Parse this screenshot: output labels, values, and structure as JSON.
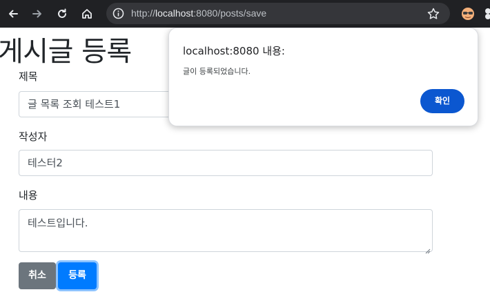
{
  "browser": {
    "url_scheme": "http://",
    "url_host": "localhost",
    "url_rest": ":8080/posts/save"
  },
  "page": {
    "title": "게시글 등록",
    "title_label": "제목",
    "title_value": "글 목록 조회 테스트1",
    "author_label": "작성자",
    "author_value": "테스터2",
    "content_label": "내용",
    "content_value": "테스트입니다.",
    "cancel_label": "취소",
    "submit_label": "등록"
  },
  "dialog": {
    "title": "localhost:8080 내용:",
    "message": "글이 등록되었습니다.",
    "ok_label": "확인"
  },
  "colors": {
    "chrome_bg": "#202124",
    "omnibox_bg": "#35363a",
    "btn_secondary": "#6c757d",
    "btn_primary": "#007bff",
    "dialog_ok": "#0b57d0"
  }
}
